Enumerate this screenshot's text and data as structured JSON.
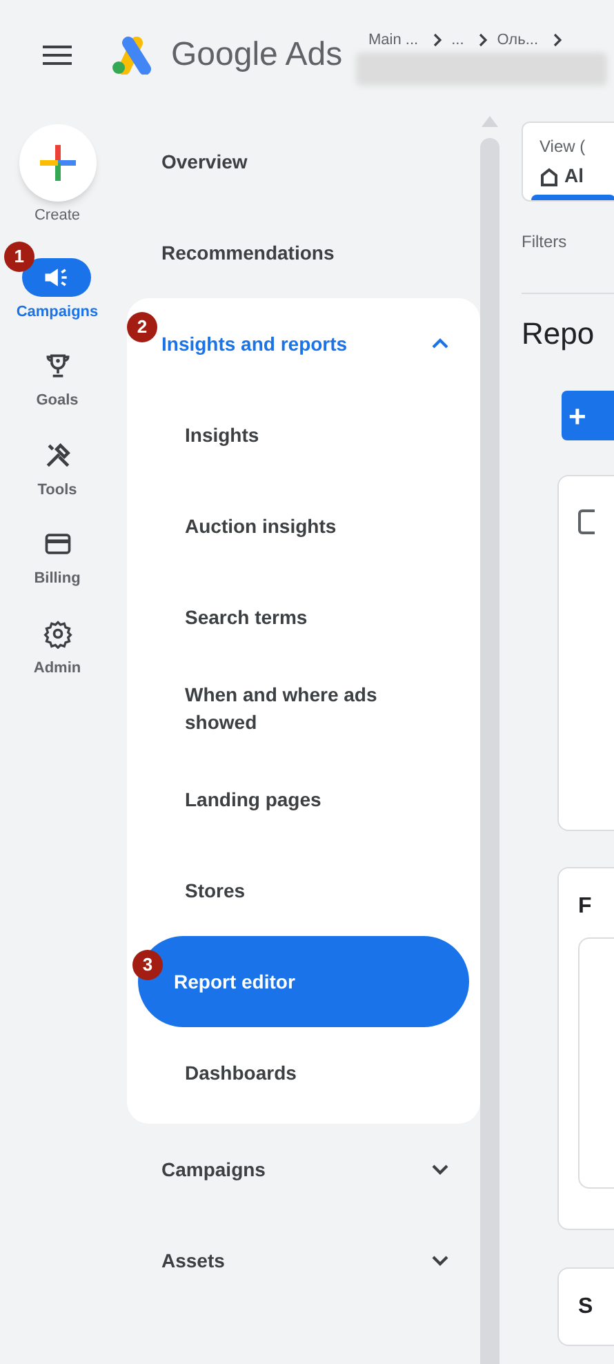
{
  "header": {
    "app_name": "Google Ads",
    "breadcrumb": [
      "Main ...",
      "...",
      "Оль..."
    ]
  },
  "rail": {
    "create": {
      "label": "Create"
    },
    "items": [
      {
        "label": "Campaigns",
        "kind": "megaphone",
        "selected": true,
        "badge": "1"
      },
      {
        "label": "Goals",
        "kind": "trophy",
        "selected": false
      },
      {
        "label": "Tools",
        "kind": "tools",
        "selected": false
      },
      {
        "label": "Billing",
        "kind": "card",
        "selected": false
      },
      {
        "label": "Admin",
        "kind": "gear",
        "selected": false
      }
    ]
  },
  "nav": {
    "items": [
      {
        "label": "Overview",
        "selected": false
      },
      {
        "label": "Recommendations",
        "selected": false
      },
      {
        "label": "Insights and reports",
        "selected": false,
        "expanded": true,
        "badge": "2",
        "children": [
          {
            "label": "Insights",
            "selected": false
          },
          {
            "label": "Auction insights",
            "selected": false
          },
          {
            "label": "Search terms",
            "selected": false
          },
          {
            "label": "When and where ads showed",
            "selected": false
          },
          {
            "label": "Landing pages",
            "selected": false
          },
          {
            "label": "Stores",
            "selected": false
          },
          {
            "label": "Report editor",
            "selected": true,
            "badge": "3"
          },
          {
            "label": "Dashboards",
            "selected": false
          }
        ]
      },
      {
        "label": "Campaigns",
        "selected": false,
        "expanded": false
      },
      {
        "label": "Assets",
        "selected": false,
        "expanded": false
      }
    ]
  },
  "content": {
    "view_tab": {
      "label": "View (",
      "value": "Al"
    },
    "filters": "Filters",
    "heading": "Repo",
    "add_button": "+",
    "cards": [
      {
        "kind": "icon"
      },
      {
        "kind": "titled",
        "title": "F"
      },
      {
        "kind": "titled",
        "title": "S"
      }
    ]
  }
}
